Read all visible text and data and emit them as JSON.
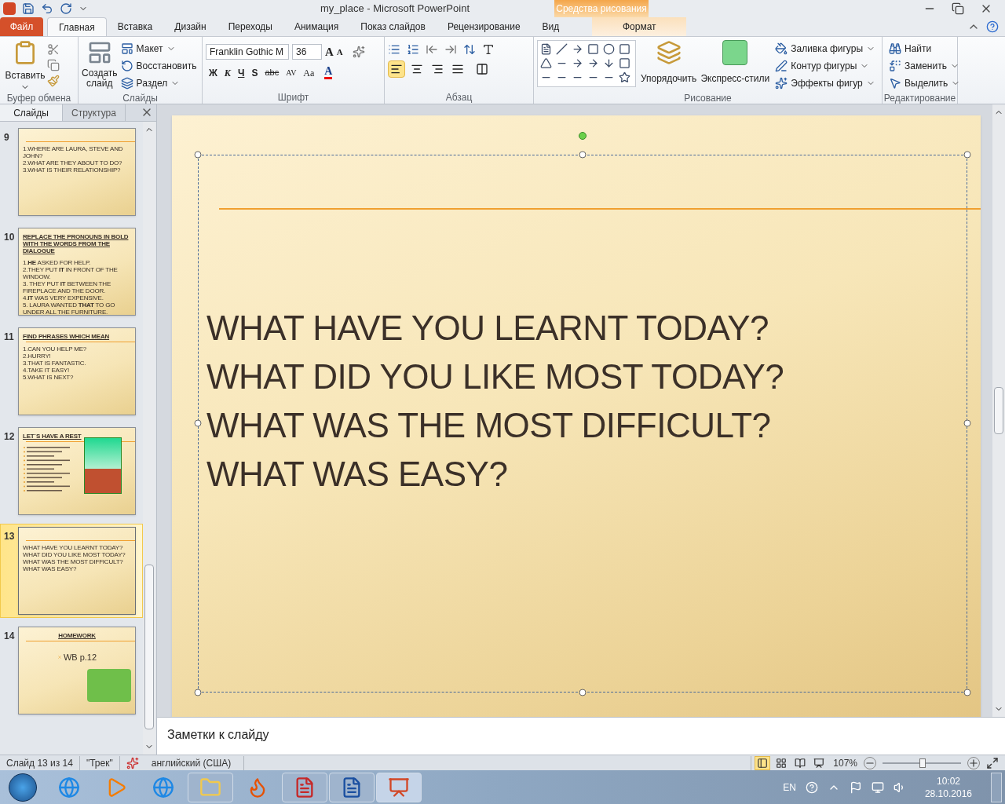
{
  "window": {
    "title": "my_place  -  Microsoft PowerPoint",
    "context_label": "Средства рисования"
  },
  "tabs": [
    {
      "label": "Файл",
      "kind": "file",
      "selected": false
    },
    {
      "label": "Главная",
      "kind": "normal",
      "selected": true
    },
    {
      "label": "Вставка",
      "kind": "normal",
      "selected": false
    },
    {
      "label": "Дизайн",
      "kind": "normal",
      "selected": false
    },
    {
      "label": "Переходы",
      "kind": "normal",
      "selected": false
    },
    {
      "label": "Анимация",
      "kind": "normal",
      "selected": false
    },
    {
      "label": "Показ слайдов",
      "kind": "normal",
      "selected": false
    },
    {
      "label": "Рецензирование",
      "kind": "normal",
      "selected": false
    },
    {
      "label": "Вид",
      "kind": "normal",
      "selected": false
    },
    {
      "label": "Формат",
      "kind": "context",
      "selected": false
    }
  ],
  "clipboard": {
    "title": "Буфер обмена",
    "paste": "Вставить"
  },
  "slides_group": {
    "title": "Слайды",
    "new_slide": "Создать слайд",
    "layout": "Макет",
    "reset": "Восстановить",
    "section": "Раздел"
  },
  "font": {
    "title": "Шрифт",
    "family": "Franklin Gothic M",
    "size": "36",
    "bold": "Ж",
    "italic": "К",
    "underline": "Ч",
    "shadow": "S",
    "strike": "abc",
    "spacing": "AV",
    "case": "Aa",
    "color_letter": "A",
    "grow": "A",
    "shrink": "A"
  },
  "paragraph": {
    "title": "Абзац",
    "align": [
      {
        "kind": "left",
        "selected": true
      },
      {
        "kind": "center",
        "selected": false
      },
      {
        "kind": "right",
        "selected": false
      },
      {
        "kind": "justify",
        "selected": false
      }
    ]
  },
  "drawing": {
    "title": "Рисование",
    "arrange": "Упорядочить",
    "quick_styles": "Экспресс-стили",
    "fill": "Заливка фигуры",
    "outline": "Контур фигуры",
    "effects": "Эффекты фигур"
  },
  "editing": {
    "title": "Редактирование",
    "find": "Найти",
    "replace": "Заменить",
    "select": "Выделить"
  },
  "panel": {
    "tabs": [
      {
        "label": "Слайды",
        "selected": true
      },
      {
        "label": "Структура",
        "selected": false
      }
    ]
  },
  "thumbnails": [
    {
      "number": "9",
      "kind": "text",
      "selected": false,
      "lines": [
        "1.WHERE  ARE LAURA,  STEVE AND JOHN?",
        "2.WHAT  ARE THEY ABOUT  TO DO?",
        "3.WHAT  IS THEIR  RELATIONSHIP?"
      ]
    },
    {
      "number": "10",
      "kind": "text",
      "selected": false,
      "title": "REPLACE THE PRONOUNS IN BOLD WITH THE WORDS FROM THE DIALOGUE",
      "lines": [
        "1.**HE** ASKED FOR HELP.",
        "2.THEY PUT **IT** IN FRONT OF THE WINDOW.",
        "3. THEY PUT **IT** BETWEEN THE FIREPLACE AND THE DOOR.",
        "4.**IT** WAS VERY EXPENSIVE.",
        "5. LAURA WANTED **THAT** TO GO UNDER ALL THE FURNITURE."
      ]
    },
    {
      "number": "11",
      "kind": "text",
      "selected": false,
      "title": "FIND PHRASES  WHICH  MEAN",
      "lines": [
        "1.CAN  YOU HELP  ME?",
        "2.HURRY!",
        "3.THAT  IS FANTASTIC.",
        "4.TAKE  IT  EASY!",
        "5.WHAT  IS NEXT?"
      ]
    },
    {
      "number": "12",
      "kind": "picture",
      "selected": false,
      "title": "LET`S  HAVE  A  REST"
    },
    {
      "number": "13",
      "kind": "text",
      "selected": true,
      "lines": [
        "WHAT  HAVE  YOU LEARNT  TODAY?",
        "WHAT  DID YOU LIKE  MOST TODAY?",
        "WHAT  WAS  THE  MOST DIFFICULT?",
        "WHAT  WAS  EASY?"
      ]
    },
    {
      "number": "14",
      "kind": "homework",
      "selected": false,
      "title": "HOMEWORK",
      "lines": [
        "WB p.12"
      ]
    }
  ],
  "slide": {
    "lines": [
      "WHAT HAVE YOU LEARNT TODAY?",
      "WHAT DID YOU LIKE MOST TODAY?",
      "WHAT WAS THE MOST DIFFICULT?",
      "WHAT WAS EASY?"
    ]
  },
  "notes": {
    "placeholder": "Заметки к слайду"
  },
  "status_bar": {
    "slide": "Слайд 13 из 14",
    "theme": "\"Трек\"",
    "language": "английский (США)",
    "views": [
      {
        "kind": "normal",
        "selected": true
      },
      {
        "kind": "sorter",
        "selected": false
      },
      {
        "kind": "reading",
        "selected": false
      },
      {
        "kind": "show",
        "selected": false
      }
    ],
    "zoom": {
      "label": "107%",
      "level": 0.51
    }
  },
  "taskbar": {
    "apps": [
      {
        "kind": "ie",
        "open": false,
        "selected": false
      },
      {
        "kind": "media",
        "open": false,
        "selected": false
      },
      {
        "kind": "ie",
        "open": false,
        "selected": false
      },
      {
        "kind": "explorer",
        "open": true,
        "selected": false
      },
      {
        "kind": "firefox",
        "open": false,
        "selected": false
      },
      {
        "kind": "acrobat",
        "open": true,
        "selected": false
      },
      {
        "kind": "word",
        "open": true,
        "selected": false
      },
      {
        "kind": "powerpoint",
        "open": true,
        "selected": true
      }
    ],
    "language": "EN",
    "time": "10:02",
    "date": "28.10.2016"
  }
}
